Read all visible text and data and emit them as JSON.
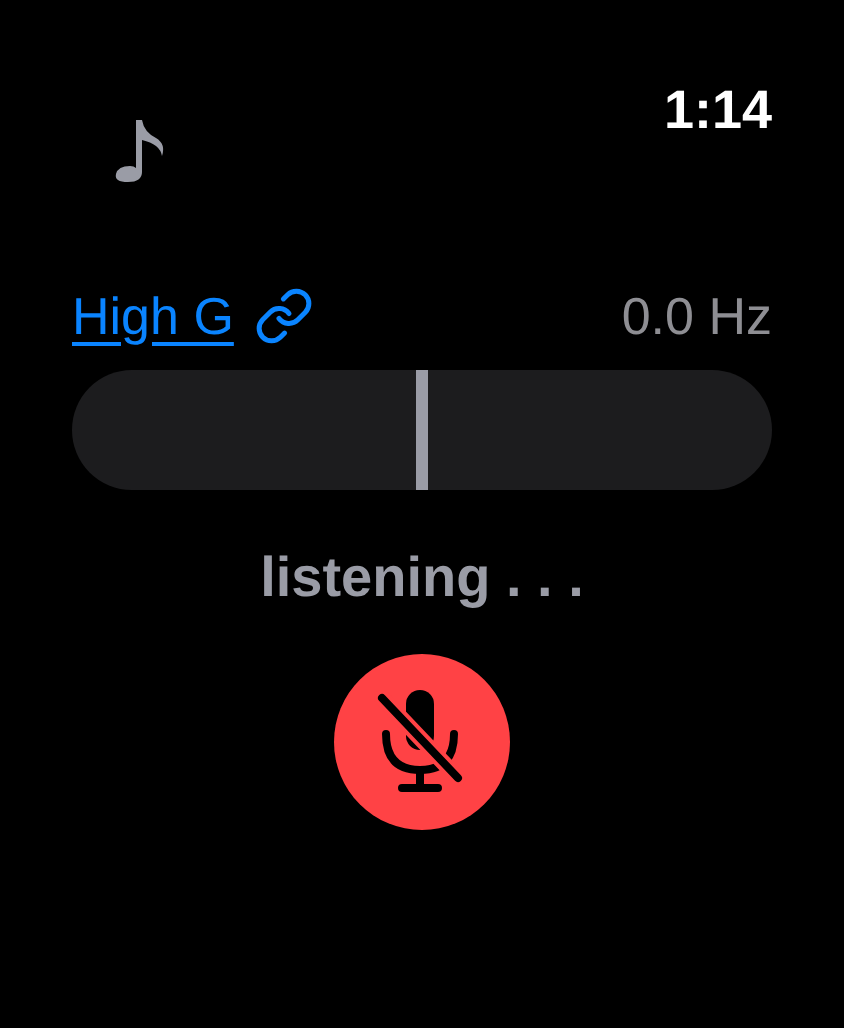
{
  "status_bar": {
    "time": "1:14"
  },
  "note": {
    "name": "High G",
    "frequency": "0.0 Hz"
  },
  "tuner": {
    "level": 0.5
  },
  "status": "listening . . .",
  "mic": {
    "muted": true
  }
}
